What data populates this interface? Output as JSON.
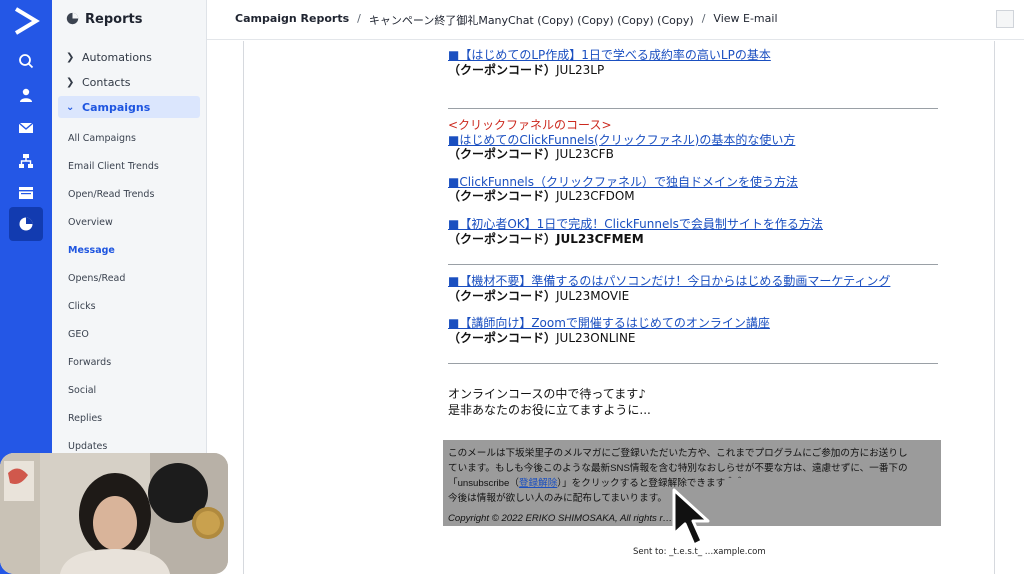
{
  "rail": {
    "icons": [
      "logo-icon",
      "search-icon",
      "contacts-icon",
      "campaigns-mail-icon",
      "automations-icon",
      "pages-icon",
      "reports-pie-icon"
    ]
  },
  "nav": {
    "title": "Reports",
    "groups": [
      {
        "label": "Automations"
      },
      {
        "label": "Contacts"
      },
      {
        "label": "Campaigns"
      }
    ],
    "items": [
      "All Campaigns",
      "Email Client Trends",
      "Open/Read Trends",
      "Overview",
      "Message",
      "Opens/Read",
      "Clicks",
      "GEO",
      "Forwards",
      "Social",
      "Replies",
      "Updates"
    ]
  },
  "breadcrumb": {
    "root": "Campaign Reports",
    "sep1": "/",
    "campaign": "キャンペーン終了御礼ManyChat (Copy) (Copy) (Copy) (Copy)",
    "sep2": "/",
    "current": "View E-mail"
  },
  "email": {
    "course1_title": "■【はじめてのLP作成】1日で学べる成約率の高いLPの基本",
    "course1_code_label": "（クーポンコード）",
    "course1_code": "JUL23LP",
    "section_heading": "<クリックファネルのコース>",
    "course2_title": "■はじめてのClickFunnels(クリックファネル)の基本的な使い方",
    "course2_code_label": "（クーポンコード）",
    "course2_code": "JUL23CFB",
    "course3_title": "■ClickFunnels（クリックファネル）で独自ドメインを使う方法",
    "course3_code_label": "（クーポンコード）",
    "course3_code": "JUL23CFDOM",
    "course4_title": "■【初心者OK】1日で完成！ClickFunnelsで会員制サイトを作る方法",
    "course4_code_label": "（クーポンコード）",
    "course4_code": "JUL23CFMEM",
    "course5_title": "■【機材不要】準備するのはパソコンだけ！今日からはじめる動画マーケティング",
    "course5_code_label": "（クーポンコード）",
    "course5_code": "JUL23MOVIE",
    "course6_title": "■【講師向け】Zoomで開催するはじめてのオンライン講座",
    "course6_code_label": "（クーポンコード）",
    "course6_code": "JUL23ONLINE",
    "closing1": "オンラインコースの中で待ってます♪",
    "closing2": "是非あなたのお役に立てますように...",
    "footer_line1": "このメールは下坂栄里子のメルマガにご登録いただいた方や、これまでプログラムにご参加の方にお送りし",
    "footer_line2": "ています。もしも今後このような最新SNS情報を含む特別なおしらせが不要な方は、遠慮せずに、一番下の",
    "footer_line3a": "「unsubscribe（",
    "footer_line3_link": "登録解除",
    "footer_line3b": "）」をクリックすると登録解除できます＾＾",
    "footer_line4": "今後は情報が欲しい人のみに配布してまいります。",
    "copyright": "Copyright © 2022 ERIKO SHIMOSAKA, All rights r… ed.",
    "sent_to": "Sent to: _t.e.s.t_ …xample.com"
  },
  "colors": {
    "rail": "#2457e6",
    "accent": "#1e55e0",
    "link": "#1a4fc0",
    "red_heading": "#cc2a1f",
    "footer_bg": "#9b9b9b"
  }
}
